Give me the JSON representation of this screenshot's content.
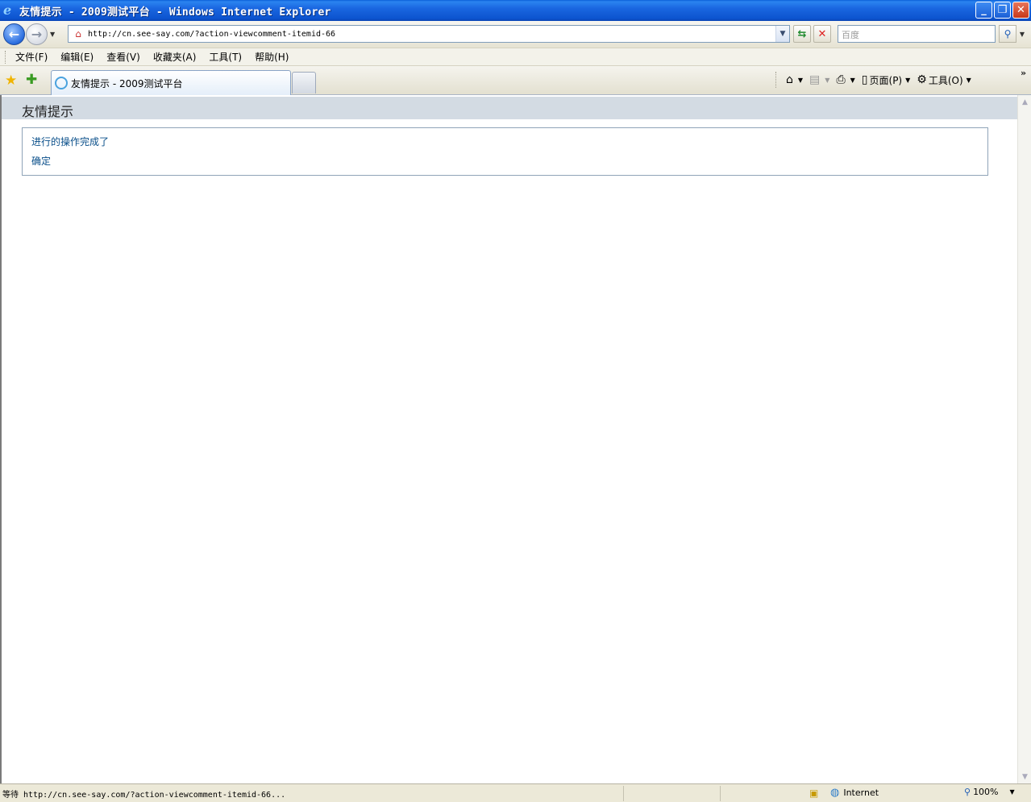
{
  "window": {
    "title": "友情提示 - 2009测试平台 - Windows Internet Explorer",
    "minimize": "_",
    "restore": "❐",
    "close": "✕"
  },
  "address": {
    "url": "http://cn.see-say.com/?action-viewcomment-itemid-66",
    "search_placeholder": "百度"
  },
  "menu": {
    "items": [
      {
        "label": "文件(F)"
      },
      {
        "label": "编辑(E)"
      },
      {
        "label": "查看(V)"
      },
      {
        "label": "收藏夹(A)"
      },
      {
        "label": "工具(T)"
      },
      {
        "label": "帮助(H)"
      }
    ]
  },
  "tab": {
    "label": "友情提示 - 2009测试平台"
  },
  "command_bar": {
    "page_label": "页面(P)",
    "tools_label": "工具(O)"
  },
  "page": {
    "title": "友情提示",
    "message": "进行的操作完成了",
    "ok_link": "确定"
  },
  "status": {
    "text": "等待 http://cn.see-say.com/?action-viewcomment-itemid-66...",
    "zone": "Internet",
    "zoom": "100%"
  },
  "icons": [
    "ie-logo-icon",
    "back-arrow-icon",
    "forward-arrow-icon",
    "refresh-icon",
    "stop-icon",
    "search-icon",
    "favorites-star-icon",
    "add-favorites-icon",
    "home-icon",
    "rss-feed-icon",
    "print-icon",
    "page-icon",
    "gear-icon",
    "globe-icon",
    "zoom-icon"
  ]
}
